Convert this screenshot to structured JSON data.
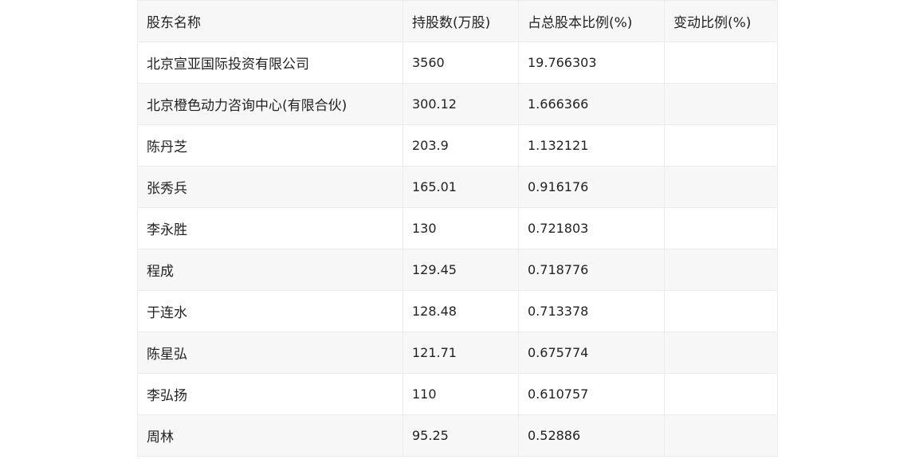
{
  "table": {
    "headers": [
      "股东名称",
      "持股数(万股)",
      "占总股本比例(%)",
      "变动比例(%)"
    ],
    "rows": [
      [
        "北京宣亚国际投资有限公司",
        "3560",
        "19.766303",
        ""
      ],
      [
        "北京橙色动力咨询中心(有限合伙)",
        "300.12",
        "1.666366",
        ""
      ],
      [
        "陈丹芝",
        "203.9",
        "1.132121",
        ""
      ],
      [
        "张秀兵",
        "165.01",
        "0.916176",
        ""
      ],
      [
        "李永胜",
        "130",
        "0.721803",
        ""
      ],
      [
        "程成",
        "129.45",
        "0.718776",
        ""
      ],
      [
        "于连水",
        "128.48",
        "0.713378",
        ""
      ],
      [
        "陈星弘",
        "121.71",
        "0.675774",
        ""
      ],
      [
        "李弘扬",
        "110",
        "0.610757",
        ""
      ],
      [
        "周林",
        "95.25",
        "0.52886",
        ""
      ]
    ]
  }
}
